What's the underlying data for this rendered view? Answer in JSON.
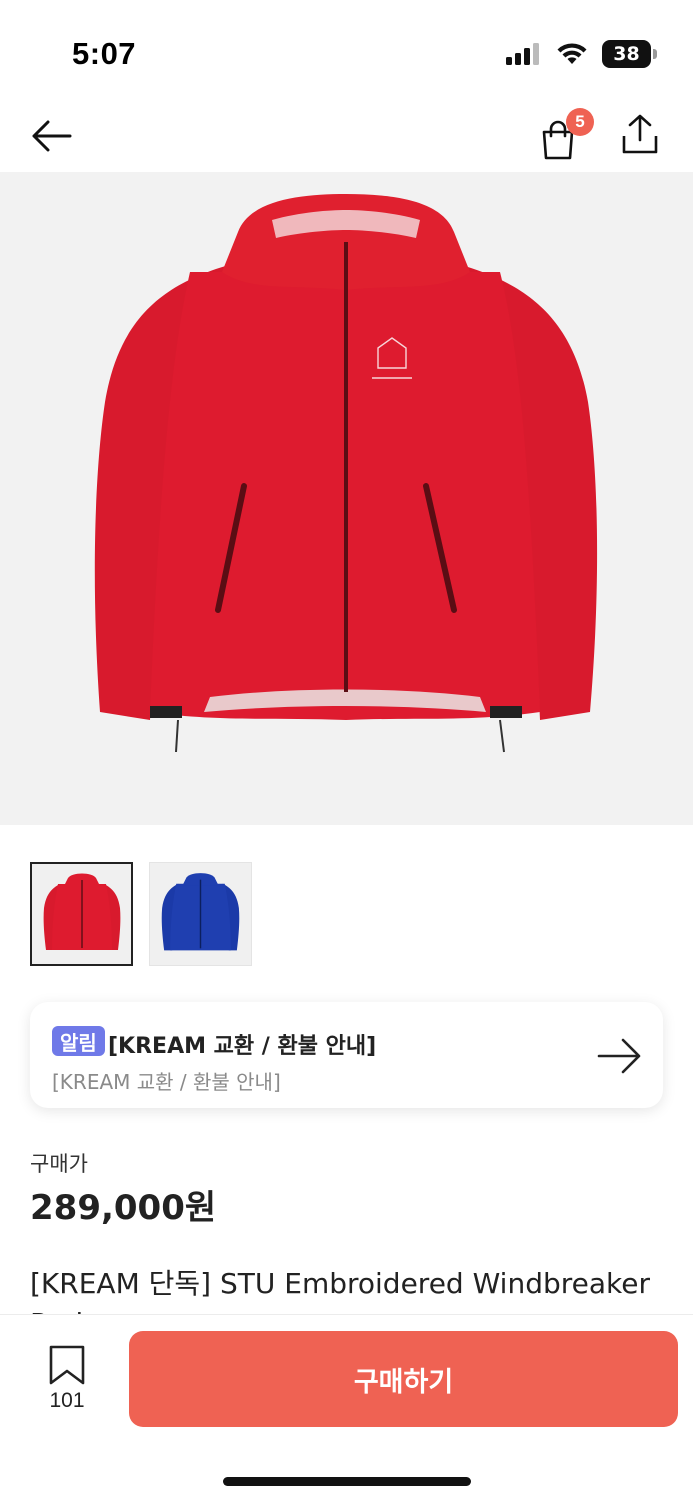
{
  "status_bar": {
    "time": "5:07",
    "battery_level": "38",
    "icons": [
      "cellular-signal-icon",
      "wifi-icon",
      "battery-icon"
    ]
  },
  "nav": {
    "cart_badge": "5",
    "icons": [
      "back-arrow-icon",
      "shopping-bag-icon",
      "share-icon"
    ]
  },
  "hero": {
    "jacket_color": "#de1b2f"
  },
  "thumbnails": [
    {
      "color": "#de1b2f",
      "selected": true
    },
    {
      "color": "#1f3fb0",
      "selected": false
    }
  ],
  "notice": {
    "tag": "알림",
    "title": "[KREAM 교환 / 환불 안내]",
    "subtitle": "[KREAM 교환 / 환불 안내]"
  },
  "price": {
    "label": "구매가",
    "value": "289,000원"
  },
  "product": {
    "name": "[KREAM 단독] STU Embroidered Windbreaker Red"
  },
  "bottom": {
    "bookmark_count": "101",
    "buy_label": "구매하기"
  },
  "colors": {
    "accent": "#ef6253",
    "tag": "#6f79e8"
  }
}
